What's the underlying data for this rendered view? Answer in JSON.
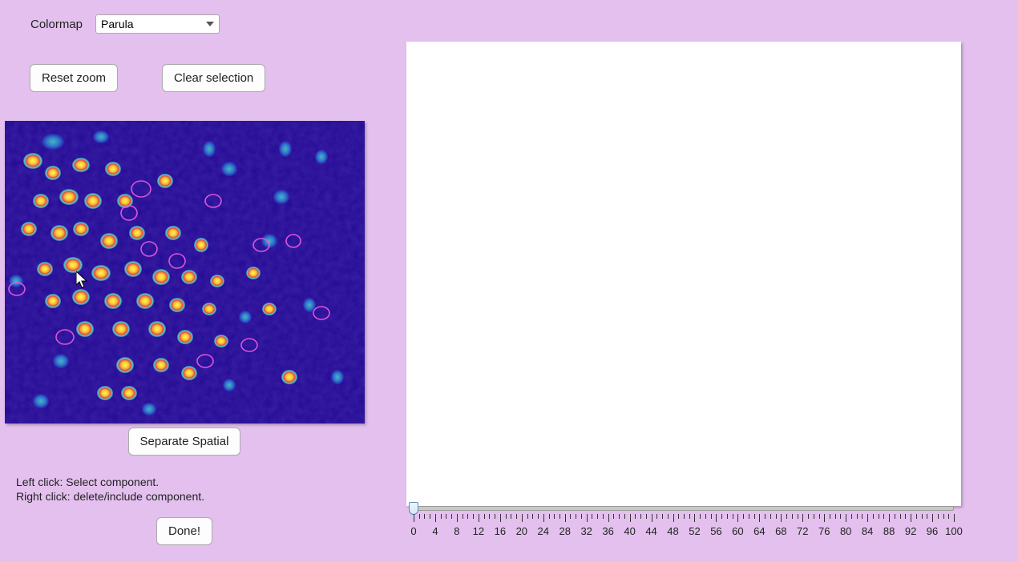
{
  "toolbar": {
    "colormap_label": "Colormap",
    "colormap_value": "Parula",
    "reset_zoom_label": "Reset zoom",
    "clear_selection_label": "Clear selection"
  },
  "actions": {
    "separate_spatial_label": "Separate Spatial",
    "done_label": "Done!"
  },
  "help": {
    "line1": "Left click: Select component.",
    "line2": "Right click: delete/include component."
  },
  "slider": {
    "min": 0,
    "max": 100,
    "value": 0,
    "major_ticks": [
      0,
      4,
      8,
      12,
      16,
      20,
      24,
      28,
      32,
      36,
      40,
      44,
      48,
      52,
      56,
      60,
      64,
      68,
      72,
      76,
      80,
      84,
      88,
      92,
      96,
      100
    ]
  }
}
